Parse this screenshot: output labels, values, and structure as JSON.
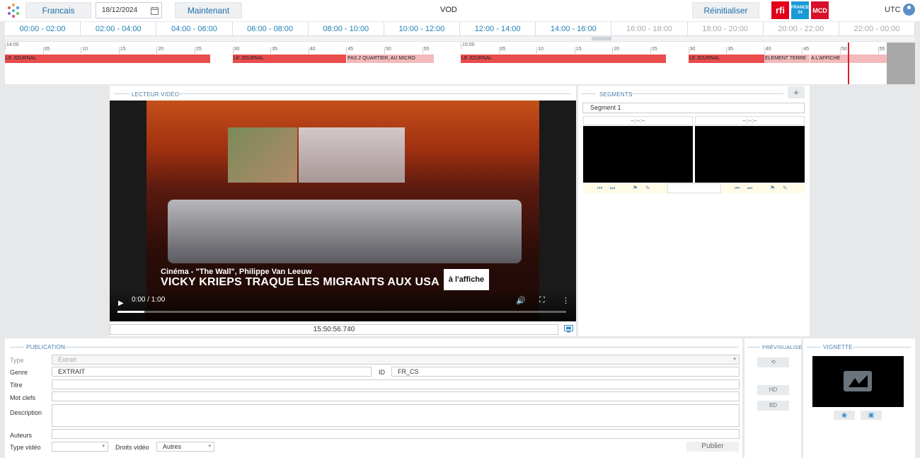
{
  "header": {
    "language_label": "Francais",
    "date_value": "18/12/2024",
    "now_label": "Maintenant",
    "title": "VOD",
    "reset_label": "Réinitialiser",
    "logos": [
      "rfi",
      "FRANCE 24",
      "MCD"
    ],
    "timezone": "UTC"
  },
  "timeline": {
    "slots": [
      {
        "label": "00:00 - 02:00",
        "state": "active"
      },
      {
        "label": "02:00 - 04:00",
        "state": "active"
      },
      {
        "label": "04:00 - 06:00",
        "state": "active"
      },
      {
        "label": "06:00 - 08:00",
        "state": "active"
      },
      {
        "label": "08:00 - 10:00",
        "state": "active"
      },
      {
        "label": "10:00 - 12:00",
        "state": "active"
      },
      {
        "label": "12:00 - 14:00",
        "state": "active"
      },
      {
        "label": "14:00 - 16:00",
        "state": "active"
      },
      {
        "label": "16:00 - 18:00",
        "state": "past"
      },
      {
        "label": "18:00 - 20:00",
        "state": "past"
      },
      {
        "label": "20:00 - 22:00",
        "state": "past"
      },
      {
        "label": "22:00 - 00:00",
        "state": "past"
      }
    ],
    "hour_labels": [
      "14:00",
      "15:00"
    ],
    "minute_labels": [
      "05",
      "10",
      "15",
      "20",
      "25",
      "30",
      "35",
      "40",
      "45",
      "50",
      "55"
    ],
    "programs": [
      {
        "title": "LE JOURNAL",
        "style": "red"
      },
      {
        "title": "LE JOURNAL",
        "style": "red"
      },
      {
        "title": "PAS 2 QUARTIER, AU MICRO",
        "style": "light"
      },
      {
        "title": "LE JOURNAL",
        "style": "red"
      },
      {
        "title": "LE JOURNAL",
        "style": "red"
      },
      {
        "title": "ELEMENT TERRE",
        "style": "light"
      },
      {
        "title": "A L'AFFICHE",
        "style": "light"
      }
    ]
  },
  "player": {
    "section_title": "LECTEUR VIDÉO",
    "lower_third_small": "Cinéma - \"The Wall\", Philippe Van Leeuw",
    "lower_third_big": "VICKY KRIEPS TRAQUE LES MIGRANTS AUX USA",
    "show_logo": "à l'affiche",
    "time_display": "0:00 / 1:00",
    "progress": 0.06,
    "timecode": "15:50:56.740"
  },
  "segments": {
    "section_title": "SEGMENTS",
    "add_label": "+",
    "segment_name": "Segment 1",
    "start_time": "--:--:--",
    "end_time": "--:--:--"
  },
  "publication": {
    "section_title": "PUBLICATION",
    "type_label": "Type",
    "type_value": "Extrait",
    "genre_label": "Genre",
    "genre_value": "EXTRAIT",
    "id_label": "ID",
    "id_value": "FR_CS",
    "titre_label": "Titre",
    "titre_value": "",
    "keywords_label": "Mot clefs",
    "keywords_value": "",
    "description_label": "Description",
    "description_value": "",
    "authors_label": "Auteurs",
    "authors_value": "",
    "video_type_label": "Type vidéo",
    "video_type_value": "",
    "rights_label": "Droits vidéo",
    "rights_value": "Autres",
    "publish_label": "Publier"
  },
  "preview": {
    "section_title": "PRÉVISUALISE",
    "buttons": [
      "HD",
      "BD"
    ]
  },
  "vignette": {
    "section_title": "VIGNETTE"
  },
  "colors": {
    "accent": "#1f7fb5",
    "segment_red": "#e84c4c",
    "segment_light": "#f3b9bb",
    "now_line": "#d8202a"
  }
}
